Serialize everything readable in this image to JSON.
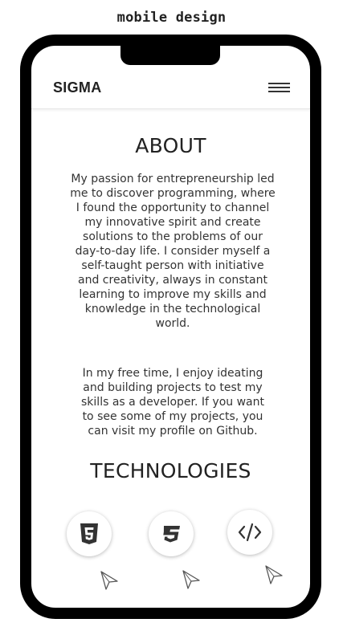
{
  "caption": "mobile design",
  "navbar": {
    "brand": "SIGMA",
    "menu_icon": "hamburger-menu-icon"
  },
  "about": {
    "title": "ABOUT",
    "paragraph_1": "My passion for entrepreneurship led me to discover programming, where I found the opportunity to channel my innovative spirit and create solutions to the problems of our day-to-day life. I consider myself a self-taught person with initiative and creativity, always in constant learning to improve my skills and knowledge in the technological world.",
    "paragraph_2": "In my free time, I enjoy ideating and building projects to test my skills as a developer. If you want to see some of my projects, you can visit my profile on Github."
  },
  "technologies": {
    "title": "TECHNOLOGIES",
    "items": [
      {
        "icon": "html5-icon"
      },
      {
        "icon": "css3-icon"
      },
      {
        "icon": "code-icon"
      }
    ]
  },
  "colors": {
    "frame": "#000000",
    "text": "#222222",
    "icon": "#333333",
    "background": "#ffffff"
  }
}
